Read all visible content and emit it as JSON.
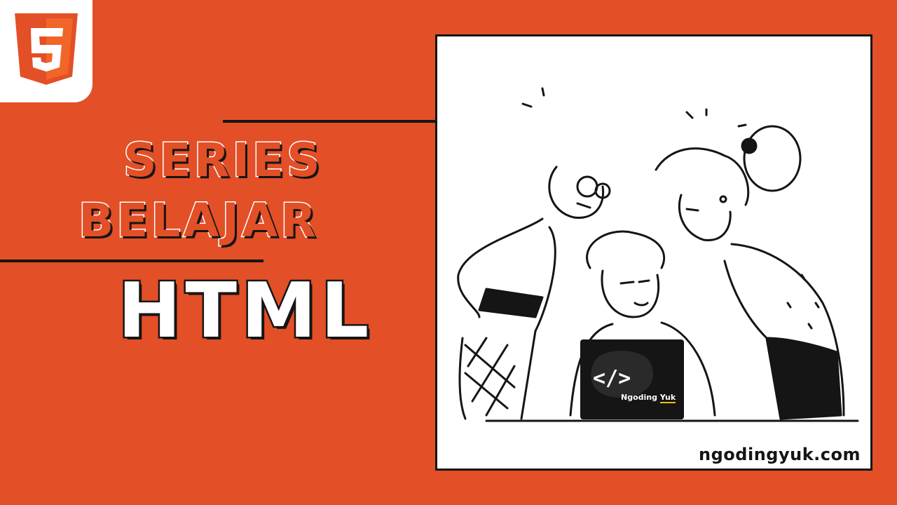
{
  "logo": {
    "icon": "html5-shield-icon",
    "glyph": "5"
  },
  "title": {
    "line1": "SERIES",
    "line2": "BELAJAR",
    "main": "HTML"
  },
  "illustration": {
    "screen_code": "</>",
    "screen_brand_main": "Ngoding",
    "screen_brand_accent": "Yuk"
  },
  "website": "ngodingyuk.com",
  "colors": {
    "background": "#e34f26",
    "outline": "#151515",
    "white": "#ffffff",
    "accent": "#f0c000"
  }
}
